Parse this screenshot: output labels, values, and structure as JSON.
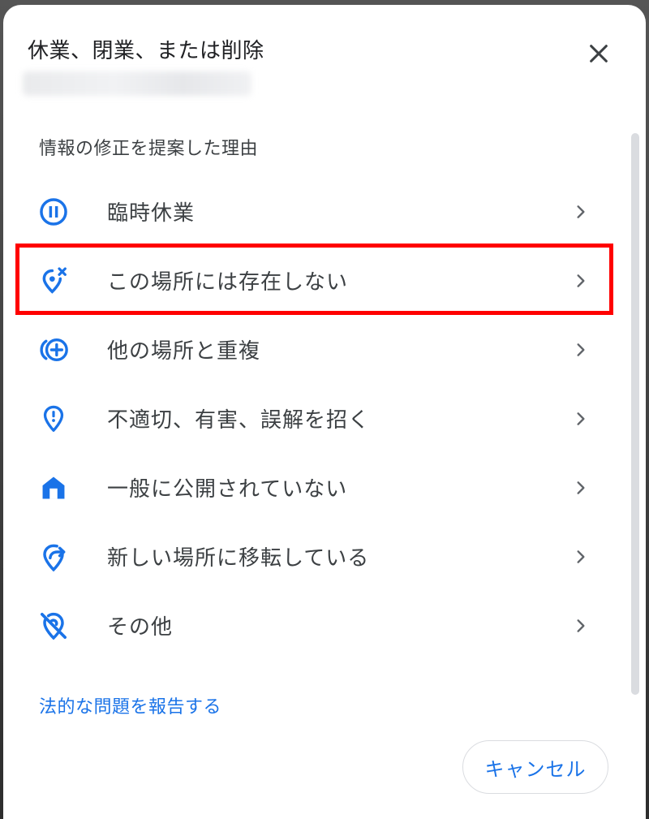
{
  "dialog": {
    "title": "休業、閉業、または削除",
    "close_icon": "close-icon",
    "section_label": "情報の修正を提案した理由",
    "reasons": [
      {
        "label": "臨時休業",
        "icon": "pause-circle-icon"
      },
      {
        "label": "この場所には存在しない",
        "icon": "location-off-x-icon"
      },
      {
        "label": "他の場所と重複",
        "icon": "add-duplicate-icon"
      },
      {
        "label": "不適切、有害、誤解を招く",
        "icon": "location-alert-icon"
      },
      {
        "label": "一般に公開されていない",
        "icon": "home-icon"
      },
      {
        "label": "新しい場所に移転している",
        "icon": "location-moved-icon"
      },
      {
        "label": "その他",
        "icon": "location-off-icon"
      }
    ],
    "legal_link": "法的な問題を報告する",
    "cancel_label": "キャンセル"
  },
  "colors": {
    "accent": "#1a73e8",
    "highlight": "#ff0000",
    "text_primary": "#202124",
    "text_secondary": "#3c4043"
  }
}
